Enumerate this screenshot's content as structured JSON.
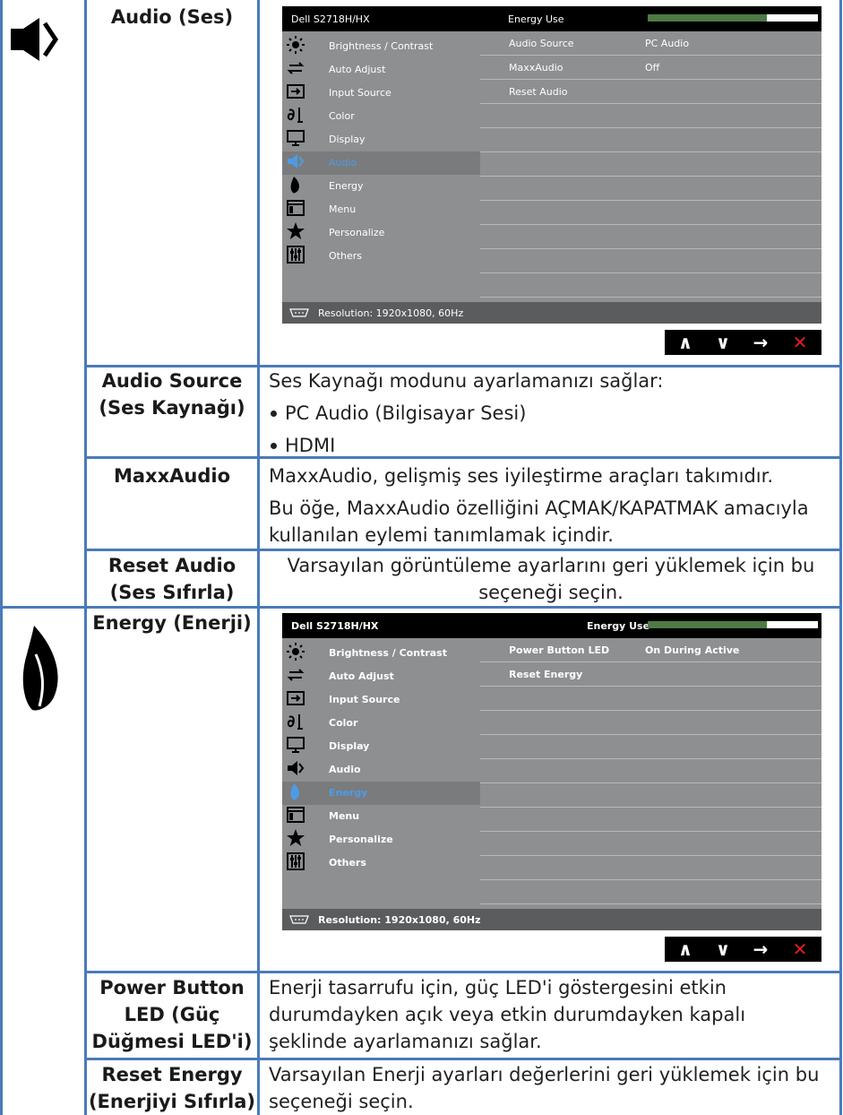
{
  "audio_section": {
    "label": "Audio (Ses)",
    "icon": "speaker-icon",
    "osd": {
      "model": "Dell S2718H/HX",
      "energy_use_label": "Energy Use",
      "energy_use_level": 0.7,
      "menu": [
        {
          "label": "Brightness / Contrast",
          "icon": "sun-icon"
        },
        {
          "label": "Auto Adjust",
          "icon": "auto-adjust-arrows-icon"
        },
        {
          "label": "Input Source",
          "icon": "input-source-icon"
        },
        {
          "label": "Color",
          "icon": "color-icon"
        },
        {
          "label": "Display",
          "icon": "monitor-icon"
        },
        {
          "label": "Audio",
          "icon": "speaker-icon",
          "selected": true
        },
        {
          "label": "Energy",
          "icon": "leaf-icon"
        },
        {
          "label": "Menu",
          "icon": "menu-window-icon"
        },
        {
          "label": "Personalize",
          "icon": "star-icon"
        },
        {
          "label": "Others",
          "icon": "sliders-icon"
        }
      ],
      "rows": [
        {
          "key": "Audio Source",
          "value": "PC Audio"
        },
        {
          "key": "MaxxAudio",
          "value": "Off"
        },
        {
          "key": "Reset Audio",
          "value": ""
        },
        {
          "key": "",
          "value": ""
        },
        {
          "key": "",
          "value": ""
        },
        {
          "key": "",
          "value": ""
        },
        {
          "key": "",
          "value": ""
        },
        {
          "key": "",
          "value": ""
        },
        {
          "key": "",
          "value": ""
        },
        {
          "key": "",
          "value": ""
        },
        {
          "key": "",
          "value": ""
        }
      ],
      "resolution": "Resolution: 1920x1080, 60Hz"
    },
    "items": [
      {
        "label": "Audio Source\n(Ses Kaynağı)",
        "description": "Ses Kaynağı modunu ayarlamanızı sağlar:",
        "bullets": [
          "PC Audio (Bilgisayar Sesi)",
          "HDMI"
        ]
      },
      {
        "label": "MaxxAudio",
        "description": "MaxxAudio, gelişmiş ses iyileştirme araçları takımıdır.",
        "description2": "Bu öğe, MaxxAudio özelliğini AÇMAK/KAPATMAK amacıyla kullanılan eylemi tanımlamak içindir."
      },
      {
        "label": "Reset Audio\n(Ses Sıfırla)",
        "description": "Varsayılan görüntüleme ayarlarını geri yüklemek için bu seçeneği seçin."
      }
    ]
  },
  "energy_section": {
    "label": "Energy (Enerji)",
    "icon": "leaf-icon",
    "osd": {
      "model": "Dell S2718H/HX",
      "energy_use_label": "Energy Use",
      "energy_use_level": 0.7,
      "menu": [
        {
          "label": "Brightness / Contrast",
          "icon": "sun-icon"
        },
        {
          "label": "Auto Adjust",
          "icon": "auto-adjust-arrows-icon"
        },
        {
          "label": "Input Source",
          "icon": "input-source-icon"
        },
        {
          "label": "Color",
          "icon": "color-icon"
        },
        {
          "label": "Display",
          "icon": "monitor-icon"
        },
        {
          "label": "Audio",
          "icon": "speaker-icon"
        },
        {
          "label": "Energy",
          "icon": "leaf-icon",
          "selected": true
        },
        {
          "label": "Menu",
          "icon": "menu-window-icon"
        },
        {
          "label": "Personalize",
          "icon": "star-icon"
        },
        {
          "label": "Others",
          "icon": "sliders-icon"
        }
      ],
      "rows": [
        {
          "key": "Power Button LED",
          "value": "On During Active"
        },
        {
          "key": "Reset Energy",
          "value": ""
        },
        {
          "key": "",
          "value": ""
        },
        {
          "key": "",
          "value": ""
        },
        {
          "key": "",
          "value": ""
        },
        {
          "key": "",
          "value": ""
        },
        {
          "key": "",
          "value": ""
        },
        {
          "key": "",
          "value": ""
        },
        {
          "key": "",
          "value": ""
        },
        {
          "key": "",
          "value": ""
        },
        {
          "key": "",
          "value": ""
        }
      ],
      "resolution": "Resolution: 1920x1080, 60Hz"
    },
    "items": [
      {
        "label": "Power Button\nLED (Güç\nDüğmesi LED'i)",
        "description": "Enerji tasarrufu için, güç LED'i göstergesini etkin durumdayken açık veya etkin durumdayken kapalı şeklinde ayarlamanızı sağlar."
      },
      {
        "label": "Reset Energy\n(Enerjiyi Sıfırla)",
        "description": "Varsayılan Enerji ayarları değerlerini geri yüklemek için bu seçeneği seçin."
      }
    ]
  },
  "nav_buttons": [
    {
      "icon": "up-arrow-icon",
      "glyph": "∧"
    },
    {
      "icon": "down-arrow-icon",
      "glyph": "∨"
    },
    {
      "icon": "right-arrow-icon",
      "glyph": "→"
    },
    {
      "icon": "close-icon",
      "glyph": "✕"
    }
  ],
  "colors": {
    "table_lines": "#4a7bb7",
    "selected_menu_text": "#4d9be6",
    "energy_bar": "#4d7a45",
    "close_red": "#e31d1d"
  }
}
